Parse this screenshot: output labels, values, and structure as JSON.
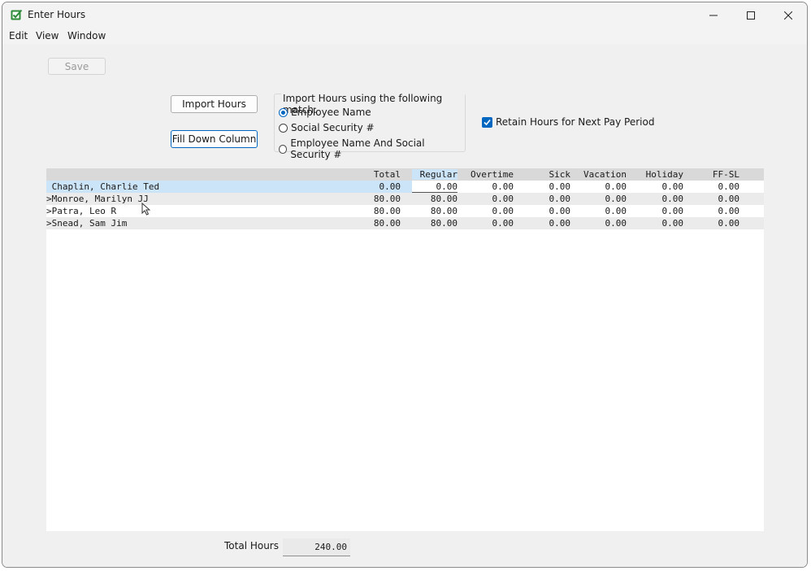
{
  "window": {
    "title": "Enter Hours"
  },
  "menu": [
    "Edit",
    "View",
    "Window"
  ],
  "toolbar": {
    "save_label": "Save"
  },
  "buttons": {
    "import_hours": "Import Hours",
    "fill_down": "Fill Down Column"
  },
  "match": {
    "title": "Import Hours using the following match:",
    "options": [
      {
        "label": "Employee Name",
        "selected": true
      },
      {
        "label": "Social Security #",
        "selected": false
      },
      {
        "label": "Employee Name And Social Security #",
        "selected": false
      }
    ]
  },
  "retain": {
    "label": "Retain Hours for Next Pay Period",
    "checked": true
  },
  "grid": {
    "columns": [
      "Total",
      "Regular",
      "Overtime",
      "Sick",
      "Vacation",
      "Holiday",
      "FF-SL"
    ],
    "rows": [
      {
        "name": " Chaplin, Charlie Ted",
        "values": [
          "0.00",
          "0.00",
          "0.00",
          "0.00",
          "0.00",
          "0.00",
          "0.00"
        ]
      },
      {
        "name": ">Monroe, Marilyn JJ",
        "values": [
          "80.00",
          "80.00",
          "0.00",
          "0.00",
          "0.00",
          "0.00",
          "0.00"
        ]
      },
      {
        "name": ">Patra, Leo R",
        "values": [
          "80.00",
          "80.00",
          "0.00",
          "0.00",
          "0.00",
          "0.00",
          "0.00"
        ]
      },
      {
        "name": ">Snead, Sam Jim",
        "values": [
          "80.00",
          "80.00",
          "0.00",
          "0.00",
          "0.00",
          "0.00",
          "0.00"
        ]
      }
    ]
  },
  "totals": {
    "label": "Total Hours",
    "value": "240.00"
  },
  "colors": {
    "accent": "#0067c0",
    "selected_row": "#cce4f7",
    "header": "#d9d9d9"
  }
}
